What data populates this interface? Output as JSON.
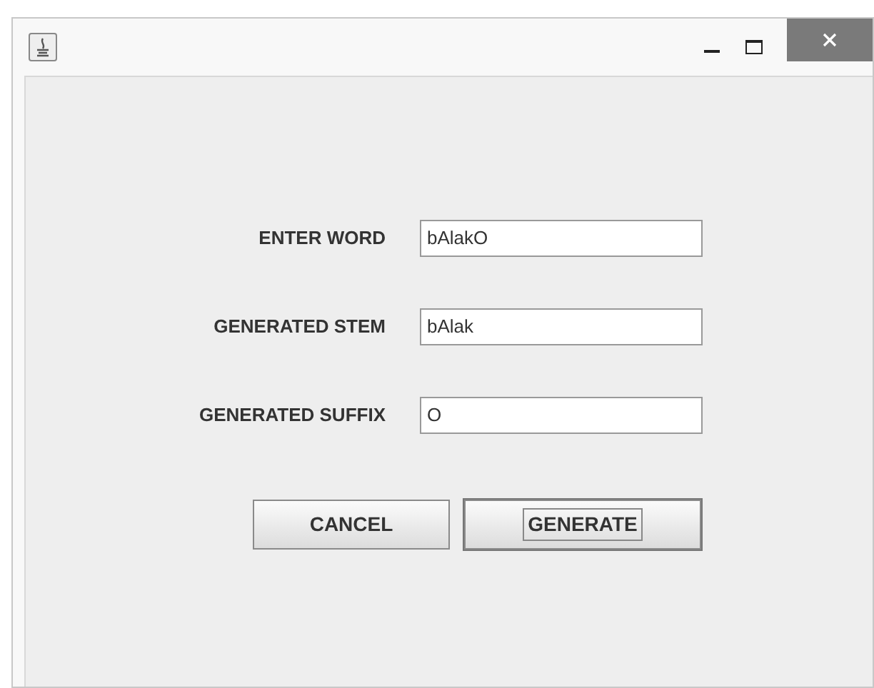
{
  "fields": [
    {
      "label": "ENTER WORD",
      "value": "bAlakO"
    },
    {
      "label": "GENERATED STEM",
      "value": "bAlak"
    },
    {
      "label": "GENERATED SUFFIX",
      "value": "O"
    }
  ],
  "buttons": [
    {
      "label": "CANCEL",
      "focused": false
    },
    {
      "label": "GENERATE",
      "focused": true
    }
  ]
}
